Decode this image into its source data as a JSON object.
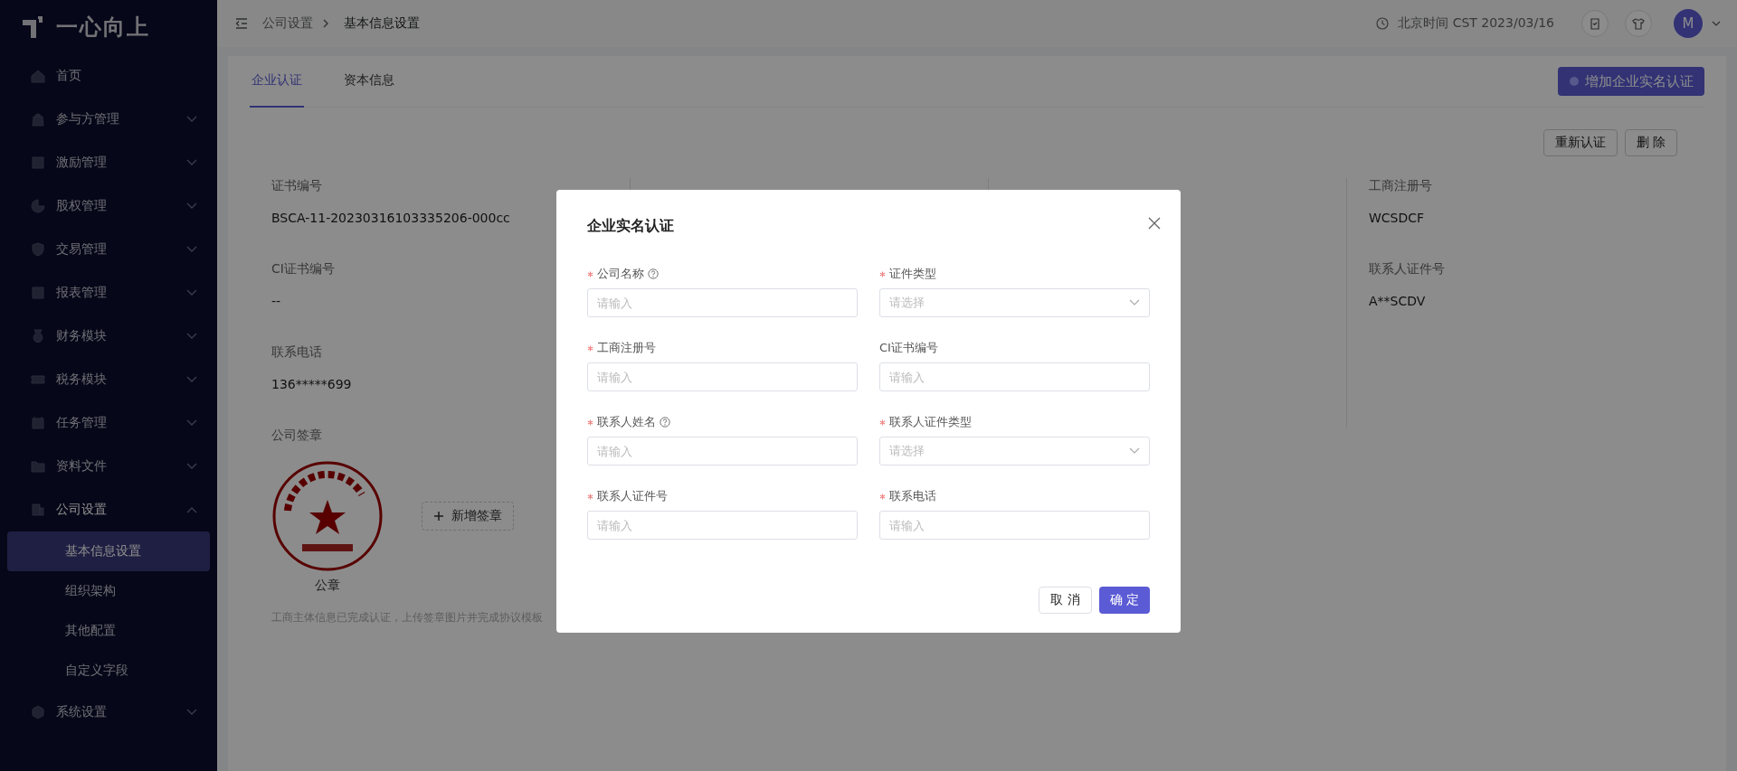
{
  "sidebar": {
    "logo": "一心向上",
    "items": [
      {
        "label": "首页"
      },
      {
        "label": "参与方管理",
        "expanded": false
      },
      {
        "label": "激励管理",
        "expanded": false
      },
      {
        "label": "股权管理",
        "expanded": false
      },
      {
        "label": "交易管理",
        "expanded": false
      },
      {
        "label": "报表管理",
        "expanded": false
      },
      {
        "label": "财务模块",
        "expanded": false
      },
      {
        "label": "税务模块",
        "expanded": false
      },
      {
        "label": "任务管理",
        "expanded": false
      },
      {
        "label": "资料文件",
        "expanded": false
      },
      {
        "label": "公司设置",
        "expanded": true,
        "children": [
          {
            "label": "基本信息设置",
            "selected": true
          },
          {
            "label": "组织架构",
            "selected": false
          },
          {
            "label": "其他配置",
            "selected": false
          },
          {
            "label": "自定义字段",
            "selected": false
          }
        ]
      },
      {
        "label": "系统设置",
        "expanded": false
      }
    ]
  },
  "header": {
    "breadcrumb": [
      "公司设置",
      "基本信息设置"
    ],
    "time": "北京时间 CST 2023/03/16",
    "avatar": "M"
  },
  "tabs": [
    {
      "label": "企业认证",
      "selected": true
    },
    {
      "label": "资本信息",
      "selected": false
    }
  ],
  "add_button": "增加企业实名认证",
  "actions": [
    "重新认证",
    "删 除"
  ],
  "info_columns": [
    [
      {
        "label": "证书编号",
        "value": "BSCA-11-20230316103335206-000cc"
      },
      {
        "label": "CI证书编号",
        "value": "--"
      },
      {
        "label": "联系电话",
        "value": "136*****699"
      }
    ],
    [],
    [],
    [
      {
        "label": "工商注册号",
        "value": "WCSDCF"
      },
      {
        "label": "联系人证件号",
        "value": "A**SCDV"
      }
    ]
  ],
  "seal": {
    "heading": "公司签章",
    "caption": "公章",
    "add_button": "新增签章",
    "note": "工商主体信息已完成认证，上传签章图片并完成协议模板"
  },
  "dialog": {
    "title": "企业实名认证",
    "fields": [
      {
        "label": "公司名称",
        "kind": "input",
        "required": true,
        "help": true,
        "placeholder": "请输入"
      },
      {
        "label": "证件类型",
        "kind": "select",
        "required": true,
        "help": false,
        "placeholder": "请选择"
      },
      {
        "label": "工商注册号",
        "kind": "input",
        "required": true,
        "help": false,
        "placeholder": "请输入"
      },
      {
        "label": "CI证书编号",
        "kind": "input",
        "required": false,
        "help": false,
        "placeholder": "请输入"
      },
      {
        "label": "联系人姓名",
        "kind": "input",
        "required": true,
        "help": true,
        "placeholder": "请输入"
      },
      {
        "label": "联系人证件类型",
        "kind": "select",
        "required": true,
        "help": false,
        "placeholder": "请选择"
      },
      {
        "label": "联系人证件号",
        "kind": "input",
        "required": true,
        "help": false,
        "placeholder": "请输入"
      },
      {
        "label": "联系电话",
        "kind": "input",
        "required": true,
        "help": false,
        "placeholder": "请输入"
      }
    ],
    "cancel": "取 消",
    "ok": "确 定"
  }
}
